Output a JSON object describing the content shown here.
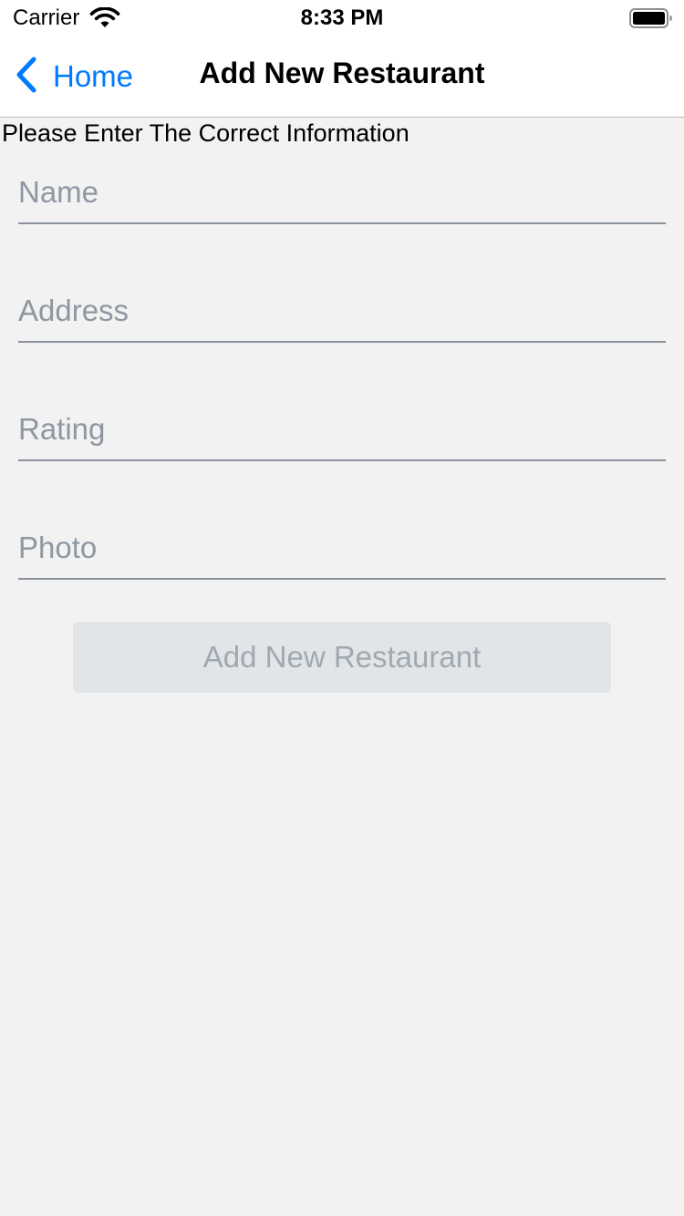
{
  "status_bar": {
    "carrier": "Carrier",
    "time": "8:33 PM",
    "icons": [
      "wifi-icon",
      "battery-icon"
    ]
  },
  "nav": {
    "back_label": "Home",
    "back_icon": "chevron-left-icon",
    "title": "Add New Restaurant",
    "accent_color": "#007aff"
  },
  "form": {
    "instructions": "Please Enter The Correct Information",
    "fields": [
      {
        "placeholder": "Name",
        "value": ""
      },
      {
        "placeholder": "Address",
        "value": ""
      },
      {
        "placeholder": "Rating",
        "value": ""
      },
      {
        "placeholder": "Photo",
        "value": ""
      }
    ],
    "submit_label": "Add New Restaurant",
    "submit_enabled": false
  }
}
